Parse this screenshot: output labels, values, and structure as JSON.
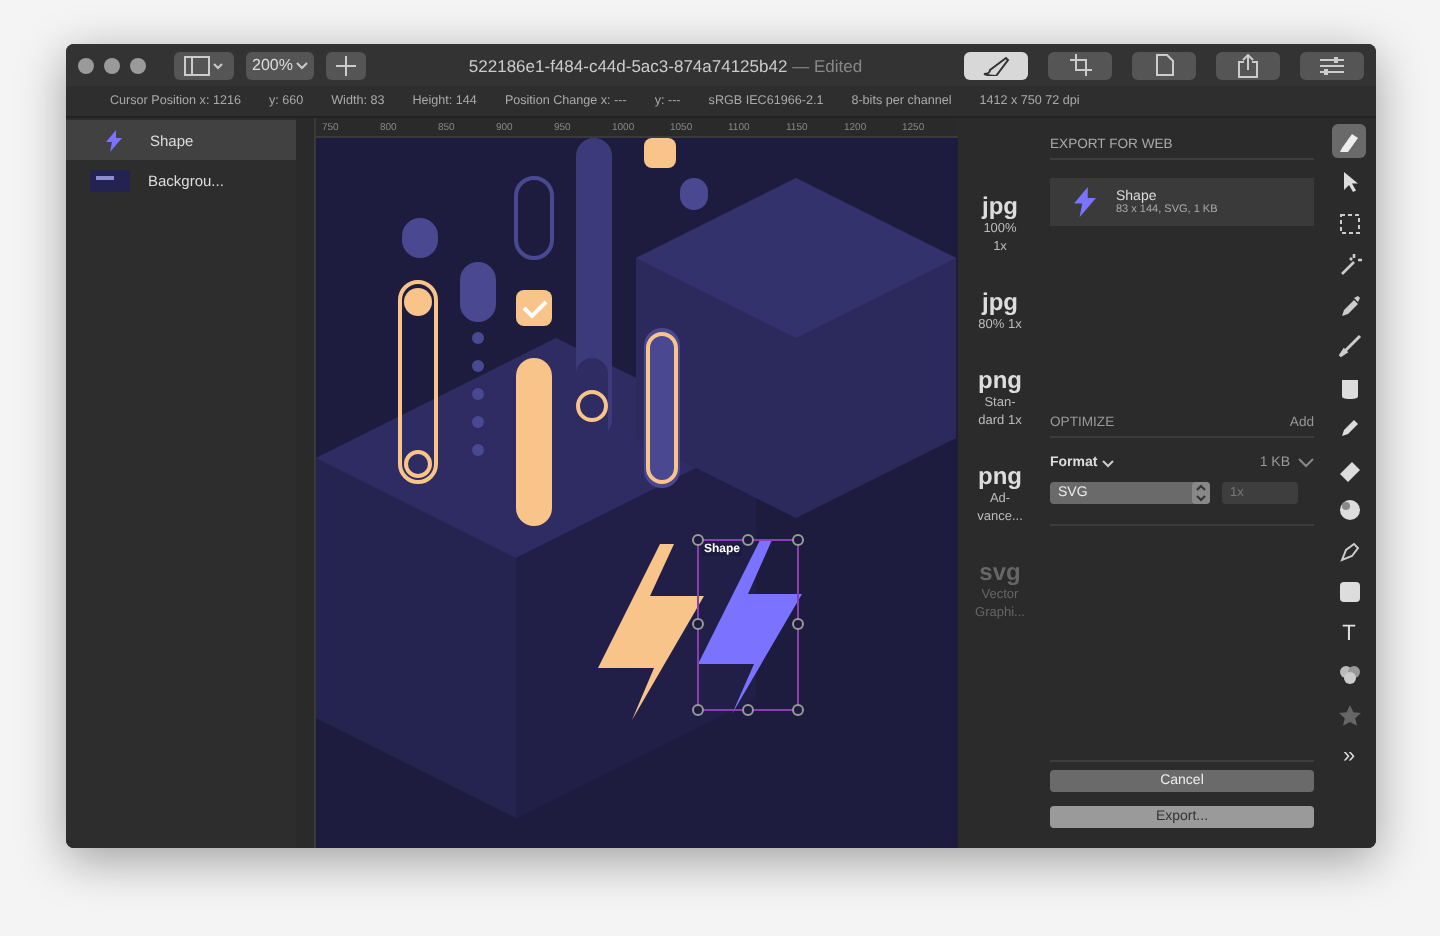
{
  "window": {
    "title": "522186e1-f484-c44d-5ac3-874a74125b42",
    "title_suffix": "— Edited",
    "zoom": "200%"
  },
  "toolbar_buttons": [
    {
      "kind": "brush",
      "selected": true
    },
    {
      "kind": "crop",
      "selected": false
    },
    {
      "kind": "document",
      "selected": false
    },
    {
      "kind": "share",
      "selected": false
    },
    {
      "kind": "sliders",
      "selected": false
    }
  ],
  "info_bar": [
    "Cursor Position x: 1216",
    "y: 660",
    "Width: 83",
    "Height: 144",
    "Position Change x: ---",
    "y: ---",
    "sRGB IEC61966-2.1",
    "8-bits per channel",
    "1412 x 750 72 dpi"
  ],
  "layers": [
    {
      "name": "Shape",
      "kind": "shape",
      "selected": true
    },
    {
      "name": "Backgrou...",
      "kind": "image",
      "selected": false
    }
  ],
  "ruler": {
    "ticks": [
      "750",
      "800",
      "850",
      "900",
      "950",
      "1000",
      "1050",
      "1100",
      "1150",
      "1200",
      "1250"
    ]
  },
  "canvas": {
    "selection_label": "Shape"
  },
  "export_formats": [
    {
      "format": "jpg",
      "detail": "100% 1x",
      "disabled": false
    },
    {
      "format": "jpg",
      "detail": "80% 1x",
      "disabled": false
    },
    {
      "format": "png",
      "detail": "Stan-dard 1x",
      "disabled": false
    },
    {
      "format": "png",
      "detail": "Ad-vance...",
      "disabled": false
    },
    {
      "format": "svg",
      "detail": "Vector Graphi...",
      "disabled": true
    }
  ],
  "export_panel": {
    "heading": "EXPORT FOR WEB",
    "item": {
      "name": "Shape",
      "details": "83 x 144, SVG, 1 KB"
    },
    "optimize": {
      "heading": "OPTIMIZE",
      "add": "Add",
      "format_label": "Format",
      "size": "1 KB",
      "format_value": "SVG",
      "scale_placeholder": "1x"
    },
    "buttons": [
      {
        "label": "Cancel",
        "kind": "secondary"
      },
      {
        "label": "Export...",
        "kind": "primary"
      }
    ]
  },
  "tools": [
    {
      "kind": "paint",
      "selected": true
    },
    {
      "kind": "arrow",
      "selected": false
    },
    {
      "kind": "marquee",
      "selected": false
    },
    {
      "kind": "wand",
      "selected": false
    },
    {
      "kind": "picker",
      "selected": false
    },
    {
      "kind": "brush",
      "selected": false
    },
    {
      "kind": "bucket",
      "selected": false
    },
    {
      "kind": "pencil",
      "selected": false
    },
    {
      "kind": "eraser",
      "selected": false
    },
    {
      "kind": "sphere",
      "selected": false
    },
    {
      "kind": "pen",
      "selected": false
    },
    {
      "kind": "rect",
      "selected": false
    },
    {
      "kind": "text",
      "label": "T",
      "selected": false
    },
    {
      "kind": "effects",
      "selected": false
    },
    {
      "kind": "star",
      "selected": false
    },
    {
      "kind": "text",
      "label": "»",
      "selected": false
    }
  ]
}
